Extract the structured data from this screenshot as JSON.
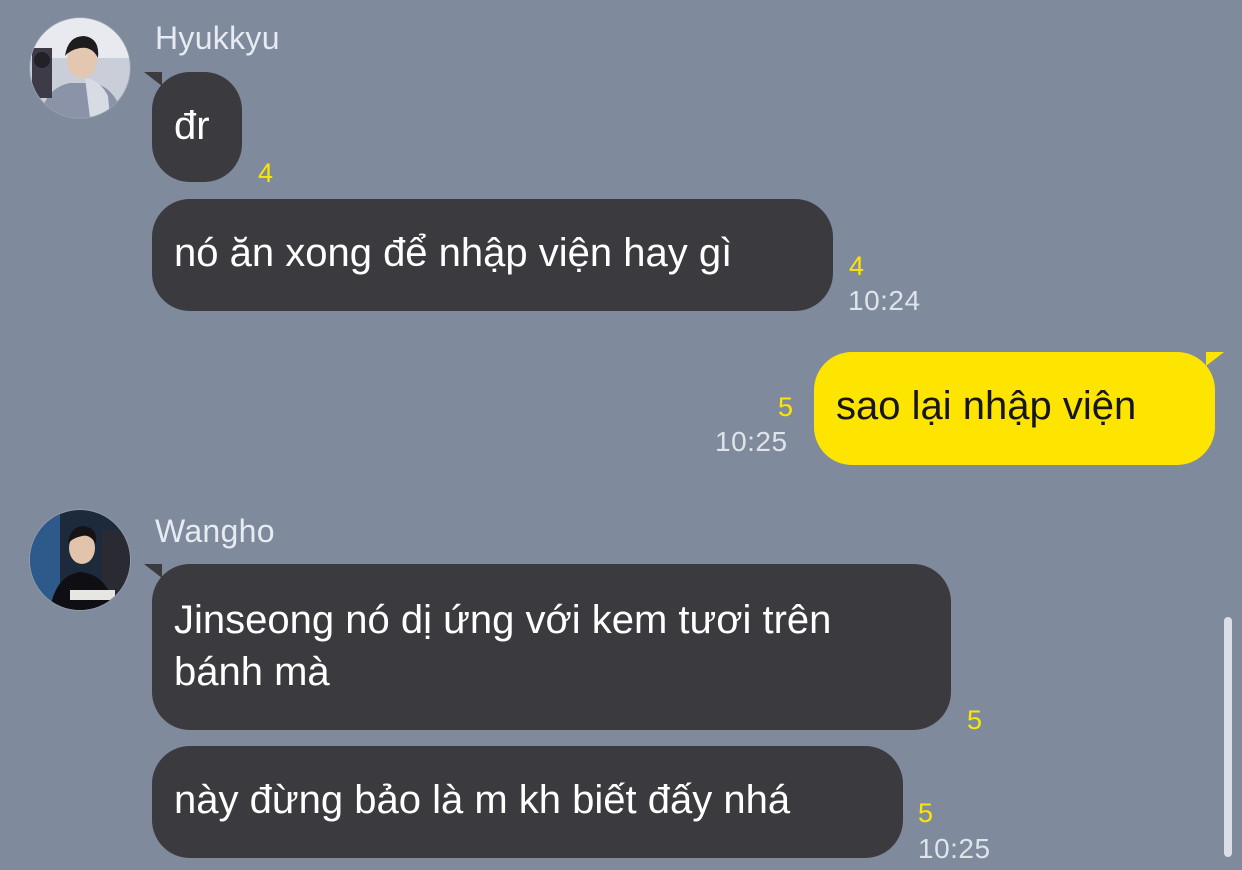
{
  "theme": {
    "background": "#7f8a9c",
    "incoming_bubble": "#3b3a3f",
    "outgoing_bubble": "#fee500",
    "unread_count_color": "#fee500"
  },
  "groups": [
    {
      "sender": "Hyukkyu",
      "avatar_icon": "profile-photo-icon",
      "messages": [
        {
          "text": "đr",
          "unread": "4",
          "time": ""
        },
        {
          "text": "nó ăn xong để nhập viện hay gì",
          "unread": "4",
          "time": "10:24"
        }
      ]
    },
    {
      "sender": "",
      "outgoing": true,
      "messages": [
        {
          "text": "sao lại nhập viện",
          "unread": "5",
          "time": "10:25"
        }
      ]
    },
    {
      "sender": "Wangho",
      "avatar_icon": "profile-photo-icon",
      "messages": [
        {
          "text": "Jinseong nó dị ứng với kem tươi trên bánh mà",
          "unread": "5",
          "time": ""
        },
        {
          "text": "này đừng bảo là m kh biết đấy nhá",
          "unread": "5",
          "time": "10:25"
        }
      ]
    }
  ]
}
